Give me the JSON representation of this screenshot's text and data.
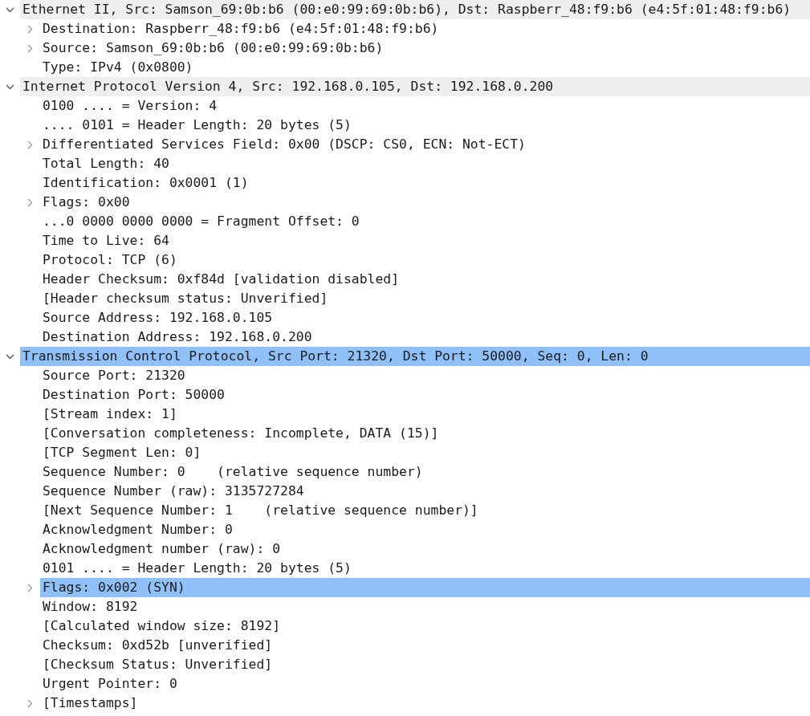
{
  "tree": [
    {
      "label": "Ethernet II, Src: Samson_69:0b:b6 (00:e0:99:69:0b:b6), Dst: Raspberr_48:f9:b6 (e4:5f:01:48:f9:b6)",
      "expanded": true,
      "selected": false,
      "children": [
        {
          "label": "Destination: Raspberr_48:f9:b6 (e4:5f:01:48:f9:b6)",
          "expanded": false,
          "selected": false
        },
        {
          "label": "Source: Samson_69:0b:b6 (00:e0:99:69:0b:b6)",
          "expanded": false,
          "selected": false
        },
        {
          "label": "Type: IPv4 (0x0800)",
          "selected": false
        }
      ]
    },
    {
      "label": "Internet Protocol Version 4, Src: 192.168.0.105, Dst: 192.168.0.200",
      "expanded": true,
      "selected": false,
      "children": [
        {
          "label": "0100 .... = Version: 4",
          "selected": false
        },
        {
          "label": ".... 0101 = Header Length: 20 bytes (5)",
          "selected": false
        },
        {
          "label": "Differentiated Services Field: 0x00 (DSCP: CS0, ECN: Not-ECT)",
          "expanded": false,
          "selected": false
        },
        {
          "label": "Total Length: 40",
          "selected": false
        },
        {
          "label": "Identification: 0x0001 (1)",
          "selected": false
        },
        {
          "label": "Flags: 0x00",
          "expanded": false,
          "selected": false
        },
        {
          "label": "...0 0000 0000 0000 = Fragment Offset: 0",
          "selected": false
        },
        {
          "label": "Time to Live: 64",
          "selected": false
        },
        {
          "label": "Protocol: TCP (6)",
          "selected": false
        },
        {
          "label": "Header Checksum: 0xf84d [validation disabled]",
          "selected": false
        },
        {
          "label": "[Header checksum status: Unverified]",
          "selected": false
        },
        {
          "label": "Source Address: 192.168.0.105",
          "selected": false
        },
        {
          "label": "Destination Address: 192.168.0.200",
          "selected": false
        }
      ]
    },
    {
      "label": "Transmission Control Protocol, Src Port: 21320, Dst Port: 50000, Seq: 0, Len: 0",
      "expanded": true,
      "selected": true,
      "children": [
        {
          "label": "Source Port: 21320",
          "selected": false
        },
        {
          "label": "Destination Port: 50000",
          "selected": false
        },
        {
          "label": "[Stream index: 1]",
          "selected": false
        },
        {
          "label": "[Conversation completeness: Incomplete, DATA (15)]",
          "selected": false
        },
        {
          "label": "[TCP Segment Len: 0]",
          "selected": false
        },
        {
          "label": "Sequence Number: 0    (relative sequence number)",
          "selected": false
        },
        {
          "label": "Sequence Number (raw): 3135727284",
          "selected": false
        },
        {
          "label": "[Next Sequence Number: 1    (relative sequence number)]",
          "selected": false
        },
        {
          "label": "Acknowledgment Number: 0",
          "selected": false
        },
        {
          "label": "Acknowledgment number (raw): 0",
          "selected": false
        },
        {
          "label": "0101 .... = Header Length: 20 bytes (5)",
          "selected": false
        },
        {
          "label": "Flags: 0x002 (SYN)",
          "expanded": false,
          "selected": true
        },
        {
          "label": "Window: 8192",
          "selected": false
        },
        {
          "label": "[Calculated window size: 8192]",
          "selected": false
        },
        {
          "label": "Checksum: 0xd52b [unverified]",
          "selected": false
        },
        {
          "label": "[Checksum Status: Unverified]",
          "selected": false
        },
        {
          "label": "Urgent Pointer: 0",
          "selected": false
        },
        {
          "label": "[Timestamps]",
          "expanded": false,
          "selected": false
        }
      ]
    }
  ]
}
